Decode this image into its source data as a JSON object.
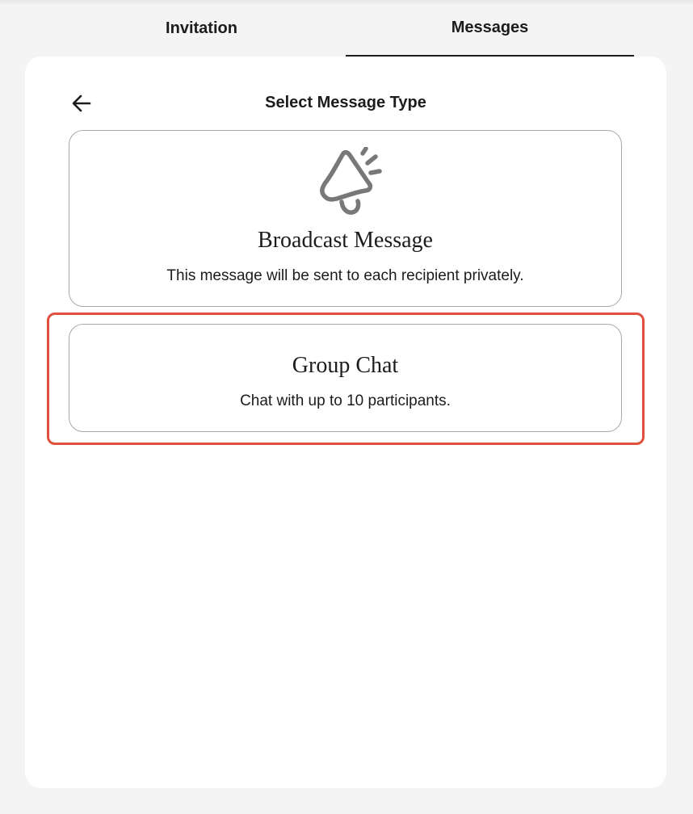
{
  "tabs": [
    {
      "label": "Invitation",
      "active": false
    },
    {
      "label": "Messages",
      "active": true
    }
  ],
  "panel": {
    "title": "Select Message Type",
    "back_icon": "arrow-left-icon"
  },
  "options": [
    {
      "icon": "megaphone-icon",
      "title": "Broadcast Message",
      "description": "This message will be sent to each recipient privately."
    },
    {
      "title": "Group Chat",
      "description": "Chat with up to 10 participants.",
      "highlighted": true
    }
  ],
  "colors": {
    "highlight": "#e0503c",
    "background": "#f4f4f5",
    "text": "#1c1c1e"
  }
}
